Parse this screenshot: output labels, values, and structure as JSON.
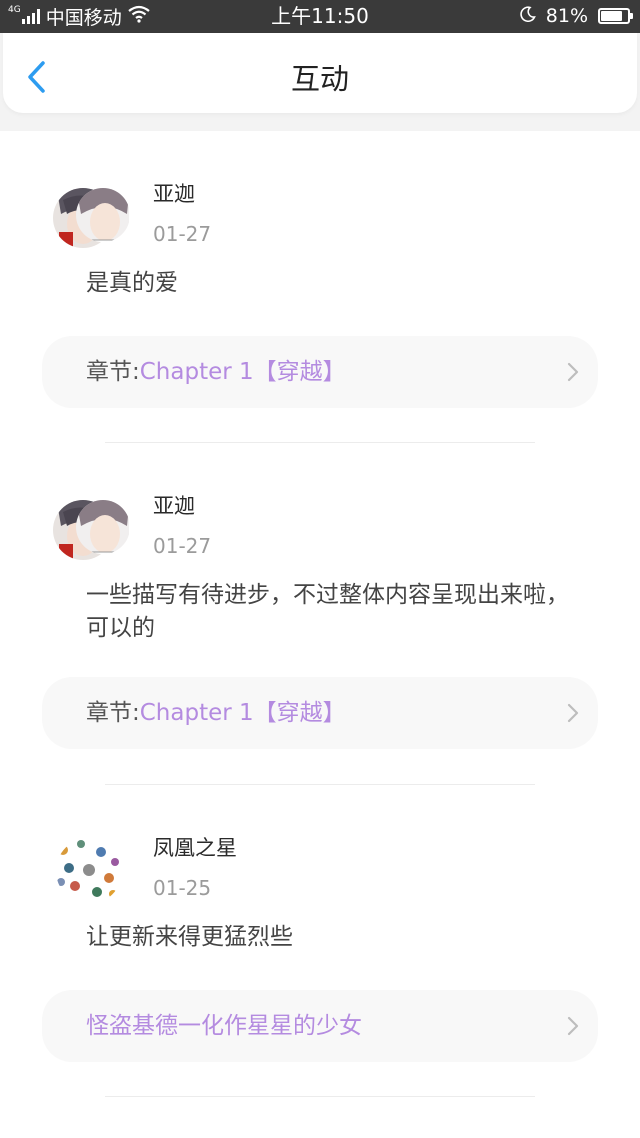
{
  "status_bar": {
    "network": "4G",
    "carrier": "中国移动",
    "time": "上午11:50",
    "battery_percent_label": "81%",
    "battery_level": 0.81
  },
  "nav": {
    "title": "互动",
    "back_icon": "chevron-left-icon",
    "accent_color": "#2d9cf0"
  },
  "posts": [
    {
      "username": "亚迦",
      "date": "01-27",
      "comment": "是真的爱",
      "chapter_prefix": "章节:",
      "chapter_name": "Chapter 1【穿越】"
    },
    {
      "username": "亚迦",
      "date": "01-27",
      "comment": "一些描写有待进步，不过整体内容呈现出来啦，可以的",
      "chapter_prefix": "章节:",
      "chapter_name": "Chapter 1【穿越】"
    },
    {
      "username": "凤凰之星",
      "date": "01-25",
      "comment": "让更新来得更猛烈些",
      "chapter_prefix": "",
      "chapter_name": "怪盗基德一化作星星的少女"
    }
  ],
  "colors": {
    "link_purple": "#b48be0",
    "status_bar_bg": "#3a3a3a"
  }
}
